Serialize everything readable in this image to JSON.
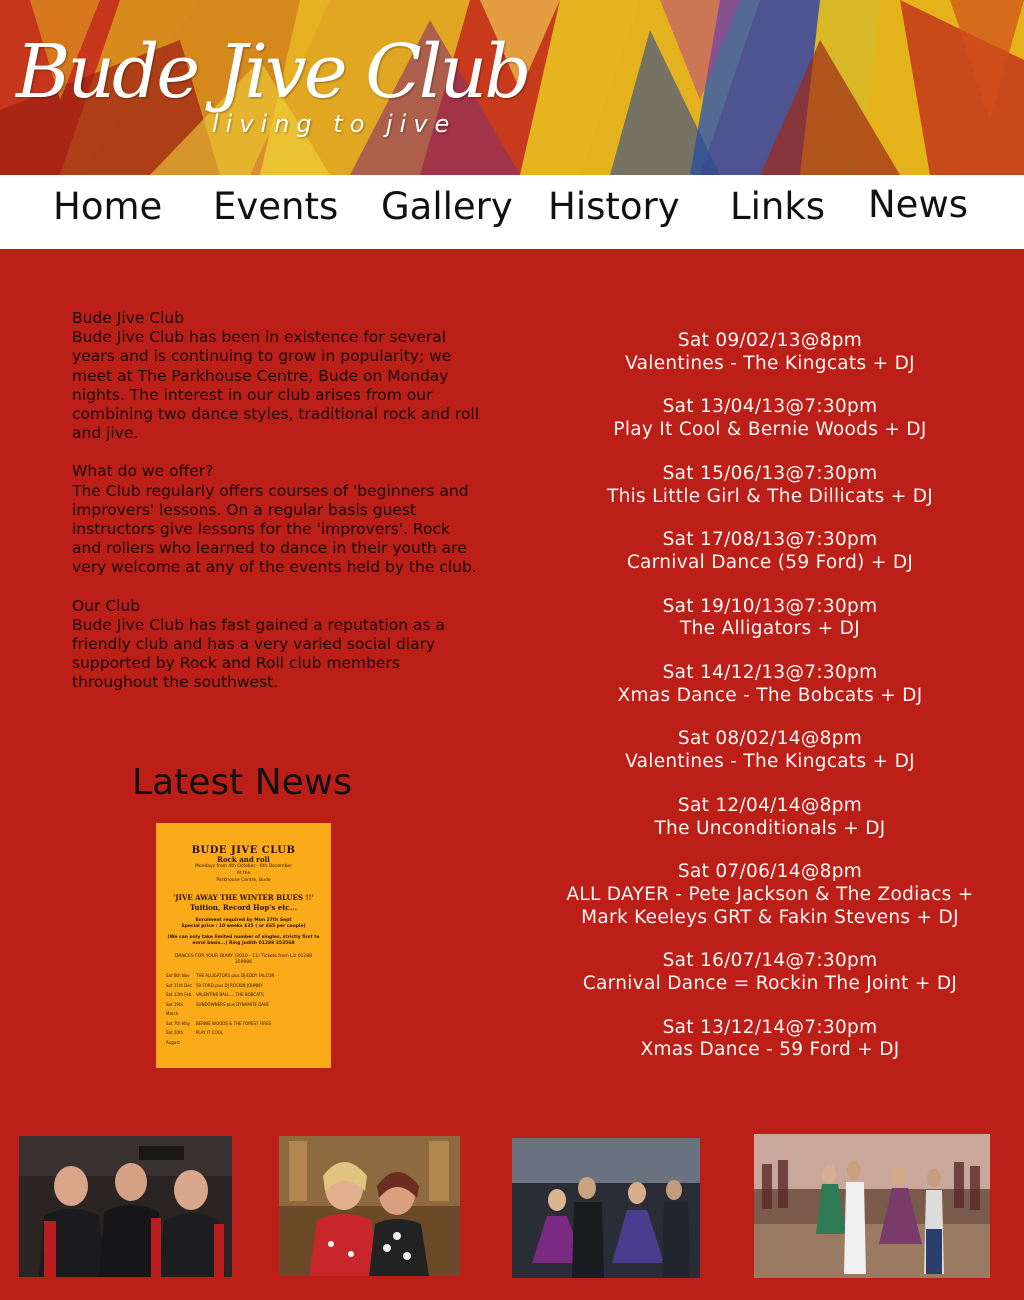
{
  "site": {
    "logo_title": "Bude Jive Club",
    "logo_tagline": "living to jive"
  },
  "nav": {
    "items": [
      "Home",
      "Events",
      "Gallery",
      "History",
      "Links",
      "News"
    ]
  },
  "about": {
    "heading1": "Bude Jive Club",
    "para1": "Bude Jive Club has been in existence for several years and is continuing to grow in popularity; we meet at The Parkhouse Centre, Bude on Monday nights. The interest in our club arises from our combining two dance styles, traditional rock and roll and jive.",
    "heading2": "What do we offer?",
    "para2": "The Club regularly offers courses of 'beginners and improvers' lessons. On a regular basis guest instructors give lessons for the 'improvers'. Rock and rollers who learned to dance in their youth are very welcome at any of the events held by the club.",
    "heading3": "Our Club",
    "para3": "Bude Jive Club has fast gained a reputation as a friendly club and has a very varied social diary supported by Rock and Roll club members throughout the southwest."
  },
  "latest_news": {
    "title": "Latest News",
    "poster": {
      "title": "BUDE JIVE CLUB",
      "line1": "Rock and roll",
      "line2": "Mondays from 4th October - 6th December",
      "line3": "At the",
      "line4": "Parkhouse Centre, Bude",
      "headline": "'JIVE AWAY THE WINTER BLUES !!'",
      "sub": "Tuition, Record Hop's etc...",
      "enrol": "Enrolment required by Mon 27th Sept",
      "price": "Special price : 10 weeks £35 ( or £65 per couple)",
      "note": "(We can only take limited number of singles, strictly first to enrol basis...) Ring Judith 01288 353568",
      "diary_title": "DANCES FOR YOUR DIARY (2010 - 11) Tickets from Liz 01288 359906",
      "diary": [
        {
          "date": "Sat 6th Nov",
          "act": "THE ALLIGATORS plus DJ EDDY FALCON"
        },
        {
          "date": "Sat 11th Dec",
          "act": "59 FORD plus DJ ROCKIN JOHNNY"
        },
        {
          "date": "Sat 12th Feb",
          "act": "VALENTINE BALL.... THE BOBCATS"
        },
        {
          "date": "Sat 19th March",
          "act": "SUNDOWNERS plus DYNAMITE DAVE"
        },
        {
          "date": "Sat 7th May",
          "act": "BERNIE WOODS & THE FOREST FIRES"
        },
        {
          "date": "Sat 20th August",
          "act": "PLAY IT COOL"
        }
      ]
    }
  },
  "events": [
    {
      "date": "Sat 09/02/13@8pm",
      "act": "Valentines - The Kingcats + DJ"
    },
    {
      "date": "Sat 13/04/13@7:30pm",
      "act": "Play It Cool & Bernie Woods + DJ"
    },
    {
      "date": "Sat 15/06/13@7:30pm",
      "act": "This Little Girl & The Dillicats + DJ"
    },
    {
      "date": "Sat 17/08/13@7:30pm",
      "act": "Carnival Dance (59 Ford) + DJ"
    },
    {
      "date": "Sat 19/10/13@7:30pm",
      "act": "The Alligators + DJ"
    },
    {
      "date": "Sat 14/12/13@7:30pm",
      "act": "Xmas Dance - The Bobcats + DJ"
    },
    {
      "date": "Sat 08/02/14@8pm",
      "act": "Valentines - The Kingcats + DJ"
    },
    {
      "date": "Sat 12/04/14@8pm",
      "act": "The Unconditionals + DJ"
    },
    {
      "date": "Sat 07/06/14@8pm",
      "act": "ALL DAYER - Pete Jackson & The Zodiacs + Mark Keeleys GRT & Fakin Stevens + DJ"
    },
    {
      "date": "Sat 16/07/14@7:30pm",
      "act": "Carnival Dance = Rockin The Joint + DJ"
    },
    {
      "date": "Sat 13/12/14@7:30pm",
      "act": "Xmas Dance - 59 Ford + DJ"
    }
  ],
  "colors": {
    "page_bg": "#bb1f17",
    "nav_bg": "#ffffff",
    "poster_bg": "#fbab19",
    "event_text": "#fff6f4"
  }
}
